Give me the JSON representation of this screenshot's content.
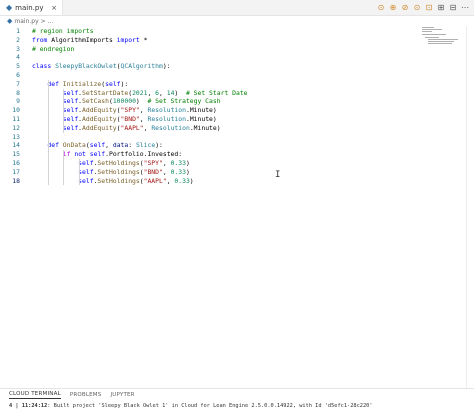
{
  "tab": {
    "filename": "main.py",
    "close": "×"
  },
  "breadcrumb": {
    "file": "main.py",
    "sep": ">",
    "rest": "..."
  },
  "actions": [
    "⊙",
    "⊕",
    "⊘",
    "⊙",
    "⊡",
    "⊞",
    "⊟",
    "⋯"
  ],
  "code_lines": [
    {
      "n": "1",
      "text": "# region imports"
    },
    {
      "n": "2",
      "text": "from AlgorithmImports import *"
    },
    {
      "n": "3",
      "text": "# endregion"
    },
    {
      "n": "4",
      "text": ""
    },
    {
      "n": "5",
      "text": "class SleepyBlackOwlet(QCAlgorithm):"
    },
    {
      "n": "6",
      "text": ""
    },
    {
      "n": "7",
      "text": "    def Initialize(self):"
    },
    {
      "n": "8",
      "text": "        self.SetStartDate(2021, 6, 14)  # Set Start Date"
    },
    {
      "n": "9",
      "text": "        self.SetCash(100000)  # Set Strategy Cash"
    },
    {
      "n": "10",
      "text": "        self.AddEquity(\"SPY\", Resolution.Minute)"
    },
    {
      "n": "11",
      "text": "        self.AddEquity(\"BND\", Resolution.Minute)"
    },
    {
      "n": "12",
      "text": "        self.AddEquity(\"AAPL\", Resolution.Minute)"
    },
    {
      "n": "13",
      "text": ""
    },
    {
      "n": "14",
      "text": "    def OnData(self, data: Slice):"
    },
    {
      "n": "15",
      "text": "        if not self.Portfolio.Invested:"
    },
    {
      "n": "16",
      "text": "            self.SetHoldings(\"SPY\", 0.33)"
    },
    {
      "n": "17",
      "text": "            self.SetHoldings(\"BND\", 0.33)"
    },
    {
      "n": "18",
      "text": "            self.SetHoldings(\"AAPL\", 0.33)"
    }
  ],
  "panel": {
    "tabs": [
      "CLOUD TERMINAL",
      "PROBLEMS",
      "JUPYTER"
    ]
  },
  "terminal": {
    "prefix": "4 | 11:24:12",
    "message": ": Built project 'Sleepy Black Owlet 1' in Cloud for Lean Engine 2.5.0.0.14922, with Id 'd5efc1-28c220'"
  },
  "colors": {
    "keyword": "#0000ff",
    "control": "#af00db",
    "string": "#a31515",
    "number": "#098658",
    "comment": "#008000",
    "function": "#795e26",
    "class": "#267f99",
    "line_number": "#237893"
  }
}
